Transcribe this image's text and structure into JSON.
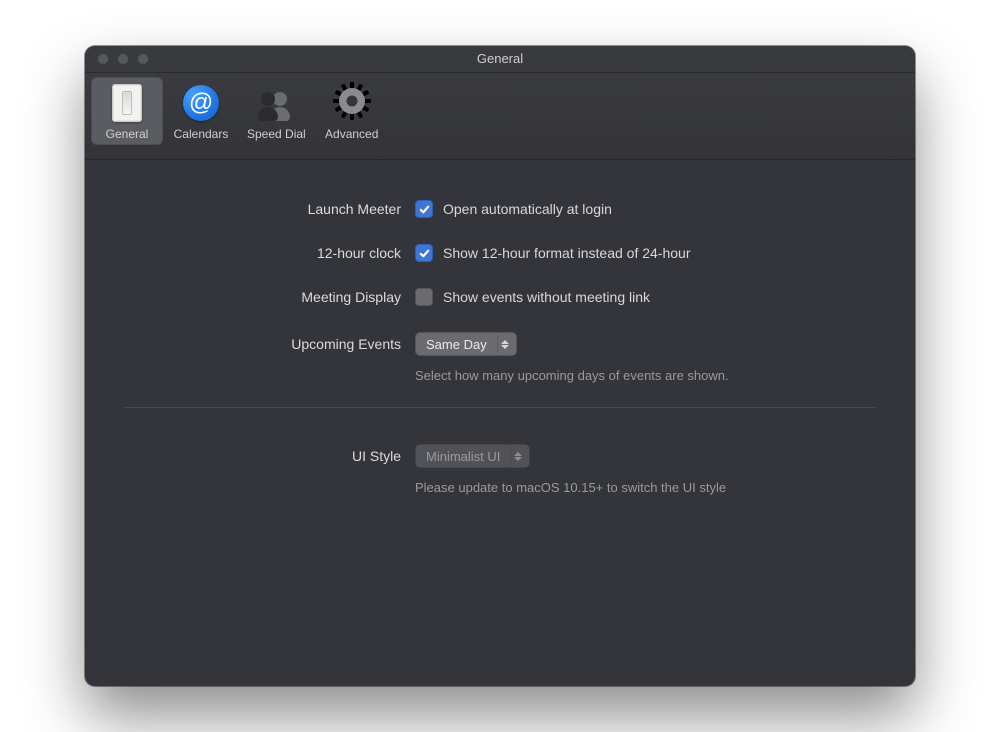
{
  "window": {
    "title": "General"
  },
  "tabs": {
    "general": {
      "label": "General"
    },
    "calendars": {
      "label": "Calendars"
    },
    "speeddial": {
      "label": "Speed Dial"
    },
    "advanced": {
      "label": "Advanced"
    }
  },
  "rows": {
    "launch": {
      "label": "Launch Meeter",
      "option": "Open automatically at login"
    },
    "clock": {
      "label": "12-hour clock",
      "option": "Show 12-hour format instead of 24-hour"
    },
    "meeting": {
      "label": "Meeting Display",
      "option": "Show events without meeting link"
    },
    "upcoming": {
      "label": "Upcoming Events",
      "value": "Same Day",
      "help": "Select how many upcoming days of events are shown."
    },
    "uistyle": {
      "label": "UI Style",
      "value": "Minimalist UI",
      "help": "Please update to macOS 10.15+ to switch the UI style"
    }
  }
}
